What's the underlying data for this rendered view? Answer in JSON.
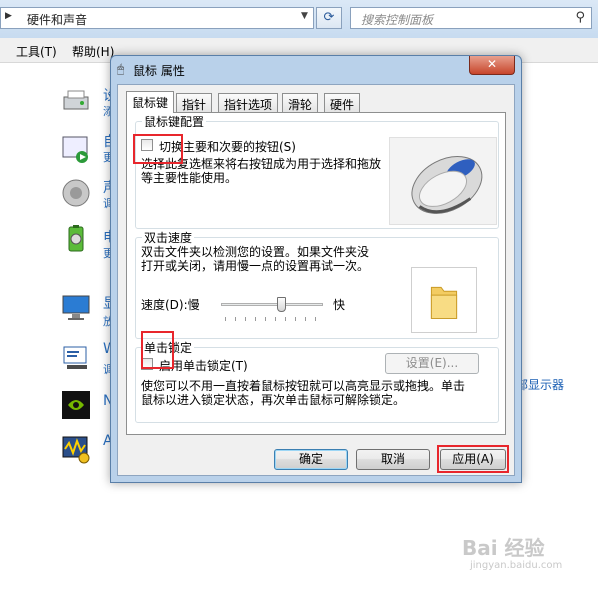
{
  "explorer": {
    "breadcrumb": "硬件和声音",
    "search_placeholder": "搜索控制面板",
    "menu": [
      "工具(T)",
      "帮助(H)"
    ],
    "items": [
      {
        "char": "设",
        "sub": "添"
      },
      {
        "char": "自",
        "sub": "更"
      },
      {
        "char": "声",
        "sub": "调"
      },
      {
        "char": "电",
        "sub": "更"
      },
      {
        "char": "显",
        "sub": "放"
      },
      {
        "char": "W",
        "sub": "调"
      },
      {
        "char": "N",
        "sub": ""
      },
      {
        "char": "A",
        "sub": ""
      }
    ],
    "side_link": "部显示器"
  },
  "dialog": {
    "title": "鼠标 属性",
    "close_symbol": "✕",
    "tabs": [
      "鼠标键",
      "指针",
      "指针选项",
      "滑轮",
      "硬件"
    ],
    "button_config": {
      "title": "鼠标键配置",
      "switch_label": "切换主要和次要的按钮(S)",
      "switch_checked": false,
      "description": [
        "选择此复选框来将右按钮成为用于选择和拖放",
        "等主要性能使用。"
      ]
    },
    "double_click": {
      "title": "双击速度",
      "description": [
        "双击文件夹以检测您的设置。如果文件夹没",
        "打开或关闭，请用慢一点的设置再试一次。"
      ],
      "speed_label": "速度(D):慢",
      "fast_label": "快",
      "speed_value": 0.6
    },
    "click_lock": {
      "title": "单击锁定",
      "enable_label": "启用单击锁定(T)",
      "enable_checked": false,
      "settings_button": "设置(E)...",
      "description": [
        "使您可以不用一直按着鼠标按钮就可以高亮显示或拖拽。单击",
        "鼠标以进入锁定状态，再次单击鼠标可解除锁定。"
      ]
    },
    "buttons": {
      "ok": "确定",
      "cancel": "取消",
      "apply": "应用(A)"
    }
  },
  "watermark": {
    "main": "Bai 经验",
    "sub": "jingyan.baidu.com"
  }
}
